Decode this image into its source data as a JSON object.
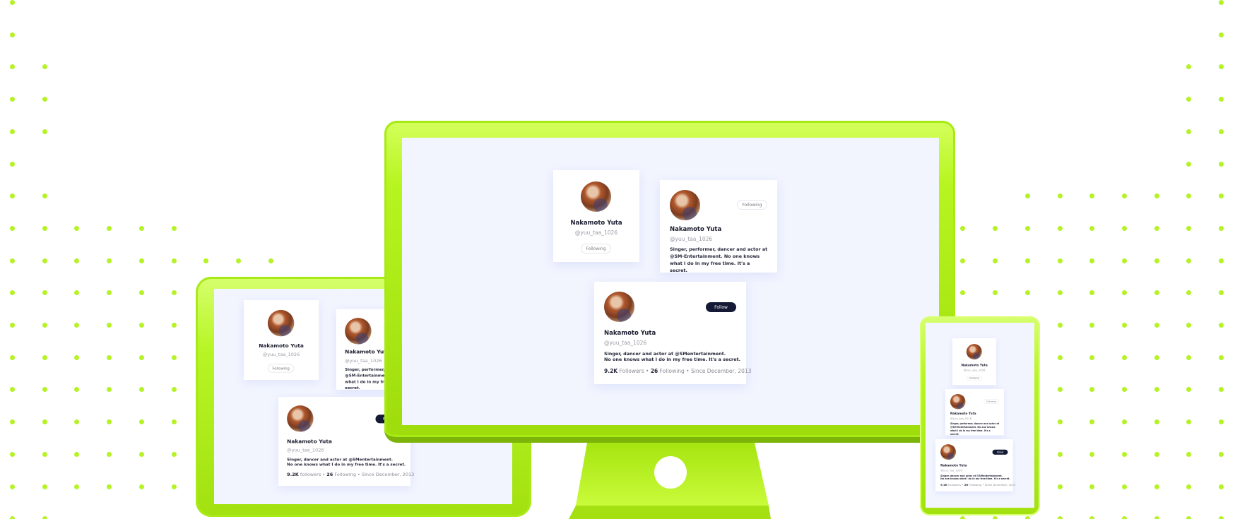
{
  "profile": {
    "name": "Nakamoto Yuta",
    "handle": "@yuu_taa_1026",
    "bio_short": "Singer, dancer and actor at @SMentertainment.",
    "bio_short_2": "No one knows what I do in my free time. It's a secret.",
    "bio_long": "Singer, performer, dancer and actor at @SM-Entertainment. No one knows what I do in my free time. It's a secret.",
    "followers": "9.2K",
    "followers_label": "Followers",
    "following": "26",
    "following_label": "Following",
    "since": "Since December, 2013",
    "left_tablet_followers_label": "followers"
  },
  "buttons": {
    "following": "Following",
    "follow": "Follow"
  },
  "colors": {
    "accent_green": "#b5f226",
    "screen_bg": "#f2f5fe",
    "follow_button": "#141a35"
  }
}
